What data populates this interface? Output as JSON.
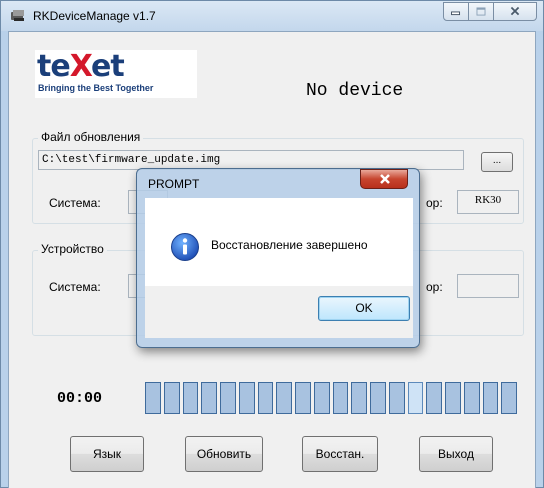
{
  "window": {
    "title": "RKDeviceManage v1.7"
  },
  "logo": {
    "brand_left": "te",
    "brand_x": "X",
    "brand_right": "et",
    "tagline": "Bringing the Best Together"
  },
  "status": "No device",
  "update_file_group": {
    "title": "Файл обновления",
    "path": "C:\\test\\firmware_update.img",
    "browse_label": "...",
    "system_label": "Система:",
    "processor_label": "ор:",
    "processor_value": "RK30"
  },
  "device_group": {
    "title": "Устройство",
    "system_label": "Система:",
    "processor_label": "ор:"
  },
  "timer": "00:00",
  "progress": {
    "cells": 20,
    "highlighted_index": 14
  },
  "buttons": {
    "language": "Язык",
    "update": "Обновить",
    "restore": "Восстан.",
    "exit": "Выход"
  },
  "dialog": {
    "title": "PROMPT",
    "message": "Восстановление завершено",
    "ok_label": "OK",
    "icon": "info-icon"
  }
}
